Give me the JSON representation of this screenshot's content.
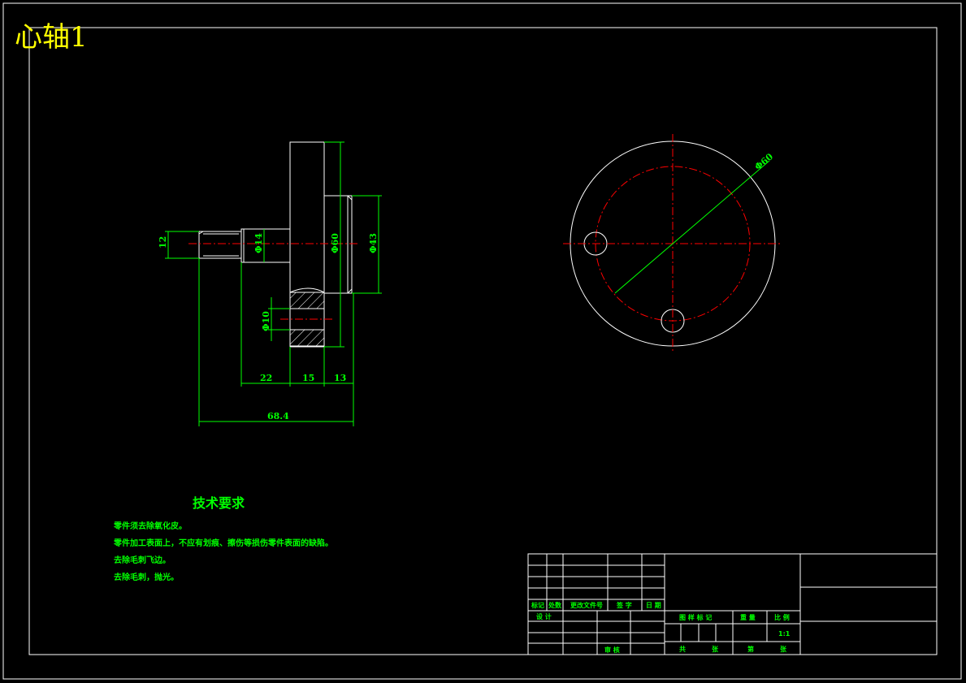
{
  "drawing_title": "心轴1",
  "dimensions": {
    "thread_dia": "12",
    "shaft_dia": "Φ14",
    "flange_dia": "Φ60",
    "boss_dia": "Φ43",
    "hole_dia": "Φ10",
    "circle_dia": "Φ60",
    "len_shaft": "22",
    "len_flange": "15",
    "len_boss": "13",
    "len_total": "68.4"
  },
  "tech_requirements": {
    "title": "技术要求",
    "items": [
      "零件须去除氧化皮。",
      "零件加工表面上，不应有划痕、擦伤等损伤零件表面的缺陷。",
      "去除毛刺飞边。",
      "去除毛刺，抛光。"
    ]
  },
  "title_block": {
    "mark": "标记",
    "count": "处数",
    "change_doc": "更改文件号",
    "signature": "签 字",
    "date": "日 期",
    "design": "设 计",
    "review": "审 核",
    "drawing_mark": "图 样 标 记",
    "weight": "重 量",
    "scale_label": "比 例",
    "scale_value": "1:1",
    "total": "共",
    "sheet_unit": "张",
    "sheet_no": "第",
    "sheet_unit2": "张"
  },
  "colors": {
    "background": "#000000",
    "outline": "#ffffff",
    "dimension": "#00ff00",
    "centerline": "#ff0000",
    "title": "#ffff00"
  }
}
